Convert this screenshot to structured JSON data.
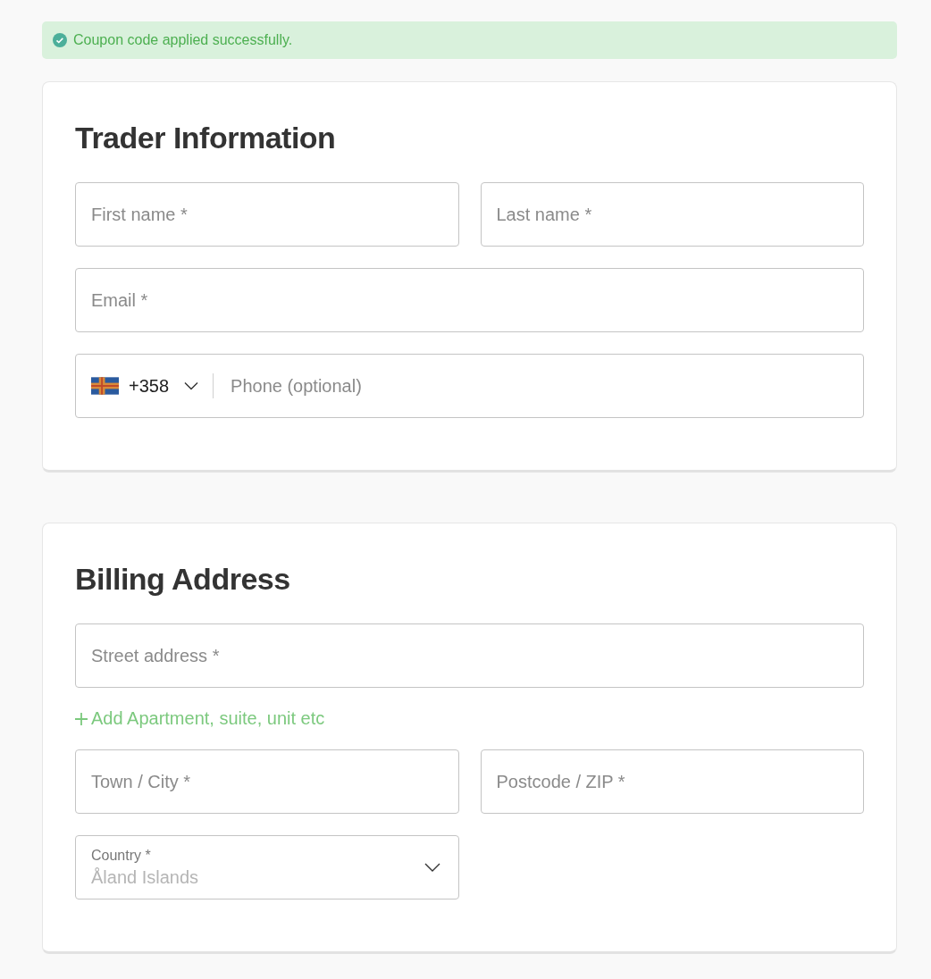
{
  "alert": {
    "message": "Coupon code applied successfully."
  },
  "sections": [
    {
      "title": "Trader Information",
      "fields": [
        {
          "kind": "text",
          "placeholder": "First name *",
          "wide": false
        },
        {
          "kind": "text",
          "placeholder": "Last name *",
          "wide": false
        },
        {
          "kind": "text",
          "placeholder": "Email *",
          "wide": true
        },
        {
          "kind": "phone",
          "dial_code": "+358",
          "placeholder": "Phone (optional)",
          "wide": true
        }
      ]
    },
    {
      "title": "Billing Address",
      "fields": [
        {
          "kind": "text",
          "placeholder": "Street address *",
          "wide": true
        },
        {
          "kind": "link",
          "label": "Add Apartment, suite, unit etc",
          "wide": true
        },
        {
          "kind": "text",
          "placeholder": "Town / City *",
          "wide": false
        },
        {
          "kind": "text",
          "placeholder": "Postcode / ZIP *",
          "wide": false
        },
        {
          "kind": "select",
          "label": "Country *",
          "value": "Åland Islands",
          "wide": false
        }
      ]
    }
  ]
}
